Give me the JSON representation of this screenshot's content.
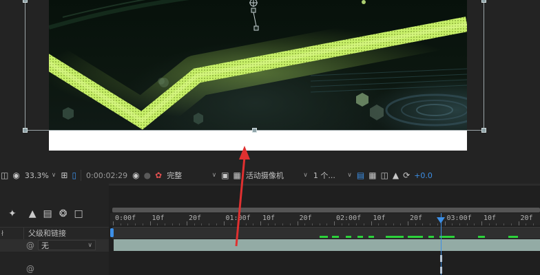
{
  "toolbar": {
    "zoom": "33.3%",
    "timecode": "0:00:02:29",
    "resolution": "完整",
    "camera": "活动摄像机",
    "views": "1 个...",
    "exposure_offset": "+0.0"
  },
  "timeline": {
    "header_left_fragment": "ł",
    "parent_column_header": "父级和链接",
    "parent_value": "无",
    "ruler_labels": [
      "0:00f",
      "10f",
      "20f",
      "01:00f",
      "10f",
      "20f",
      "02:00f",
      "10f",
      "20f",
      "03:00f",
      "10f",
      "20f"
    ]
  },
  "icons": {
    "toolbar": [
      "mask-icon",
      "zoom-chevron",
      "safe-margins-icon",
      "grid-icon",
      "camera-snapshot-icon",
      "show-snapshot-icon",
      "color-channel-icon",
      "region-of-interest-icon",
      "transparency-grid-icon",
      "3d-view-icon",
      "fast-preview-icon",
      "flowchart-icon",
      "exposure-reset-icon"
    ],
    "timeline_tools": [
      "shy-layers-icon",
      "frame-blending-icon",
      "motion-blur-icon",
      "graph-editor-icon",
      "comp-flowchart-icon"
    ]
  },
  "colors": {
    "accent_blue": "#3c8fe6",
    "keyframe_green": "#2bd33a",
    "layer_bar": "#93aba5",
    "annotation_arrow": "#e03030"
  }
}
